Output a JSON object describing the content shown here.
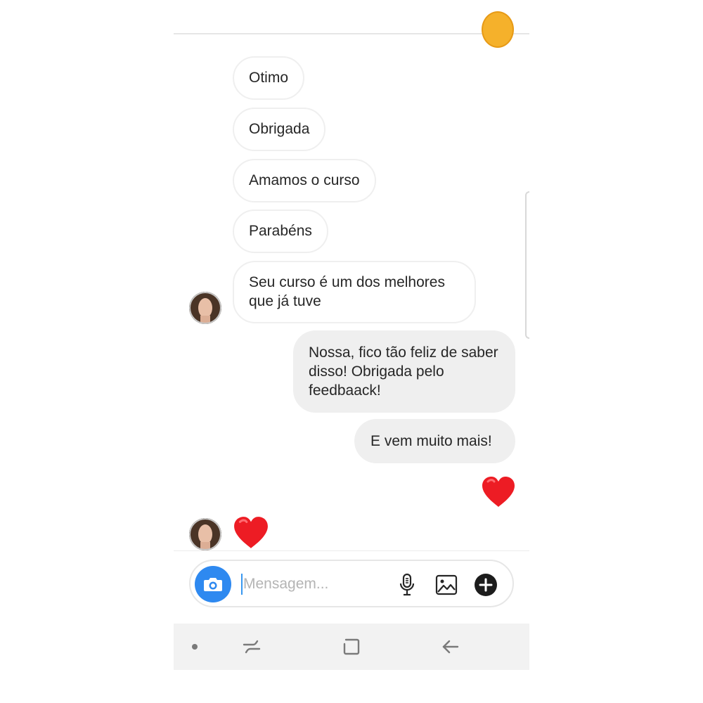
{
  "messages_in": [
    {
      "text": "Otimo"
    },
    {
      "text": "Obrigada"
    },
    {
      "text": "Amamos o curso"
    },
    {
      "text": "Parabéns"
    },
    {
      "text": "Seu curso é um dos melhores que já tuve"
    }
  ],
  "messages_out": [
    {
      "text": "Nossa, fico tão feliz de saber disso! Obrigada pelo feedbaack!"
    },
    {
      "text": "E vem muito mais!"
    }
  ],
  "composer": {
    "placeholder": "Mensagem...",
    "camera_icon": "camera-icon",
    "mic_icon": "microphone-icon",
    "gallery_icon": "gallery-icon",
    "add_icon": "plus-icon"
  },
  "reactions": {
    "out_heart": "heart-icon",
    "in_heart": "heart-icon"
  },
  "colors": {
    "accent": "#3897f0",
    "camera_button": "#2e89f0",
    "heart": "#ed1c24",
    "bubble_out": "#efefef",
    "text": "#262626"
  },
  "navigation": {
    "recent_icon": "recent-apps-icon",
    "home_icon": "home-icon",
    "back_icon": "back-arrow-icon"
  }
}
